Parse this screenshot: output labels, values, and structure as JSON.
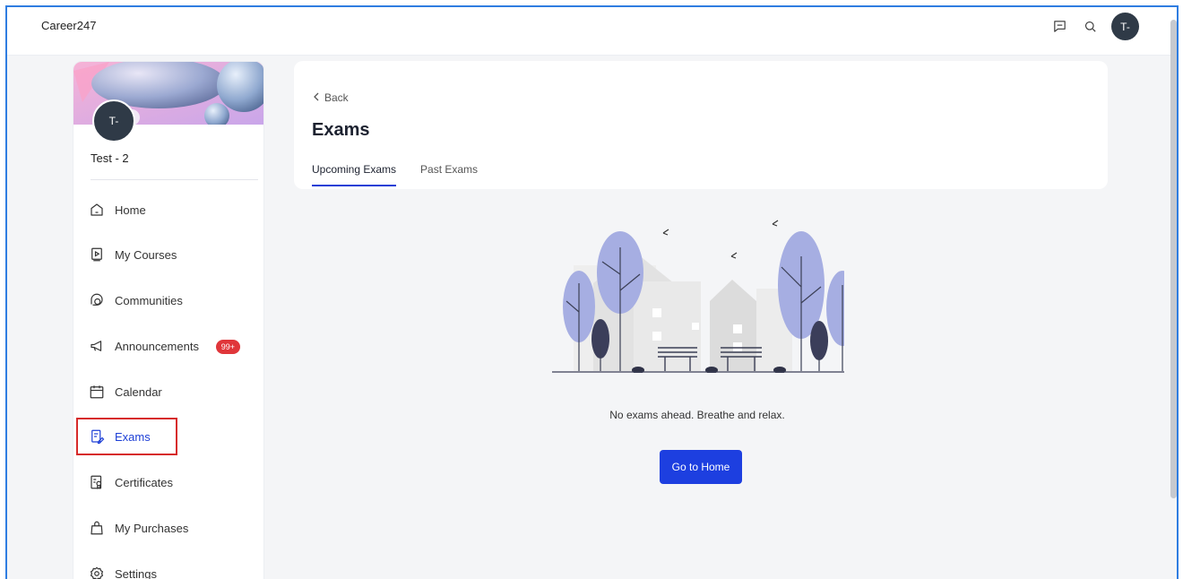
{
  "app": {
    "brand": "Career247"
  },
  "header": {
    "avatar_initials": "T-"
  },
  "profile": {
    "avatar_initials": "T-",
    "name": "Test - 2"
  },
  "sidebar": {
    "items": [
      {
        "label": "Home",
        "icon": "home-icon"
      },
      {
        "label": "My Courses",
        "icon": "play-book-icon"
      },
      {
        "label": "Communities",
        "icon": "chat-bubbles-icon"
      },
      {
        "label": "Announcements",
        "icon": "megaphone-icon",
        "badge": "99+"
      },
      {
        "label": "Calendar",
        "icon": "calendar-icon"
      },
      {
        "label": "Exams",
        "icon": "exam-edit-icon",
        "active": true
      },
      {
        "label": "Certificates",
        "icon": "certificate-icon"
      },
      {
        "label": "My Purchases",
        "icon": "shopping-bag-icon"
      },
      {
        "label": "Settings",
        "icon": "gear-icon"
      }
    ]
  },
  "main": {
    "back_label": "Back",
    "title": "Exams",
    "tabs": [
      {
        "label": "Upcoming Exams",
        "active": true
      },
      {
        "label": "Past Exams",
        "active": false
      }
    ],
    "empty_message": "No exams ahead. Breathe and relax.",
    "cta_label": "Go to Home"
  },
  "colors": {
    "accent": "#1d3fe0",
    "badge": "#e0363a",
    "avatar": "#2f3a47",
    "highlight": "#d62a2a"
  }
}
